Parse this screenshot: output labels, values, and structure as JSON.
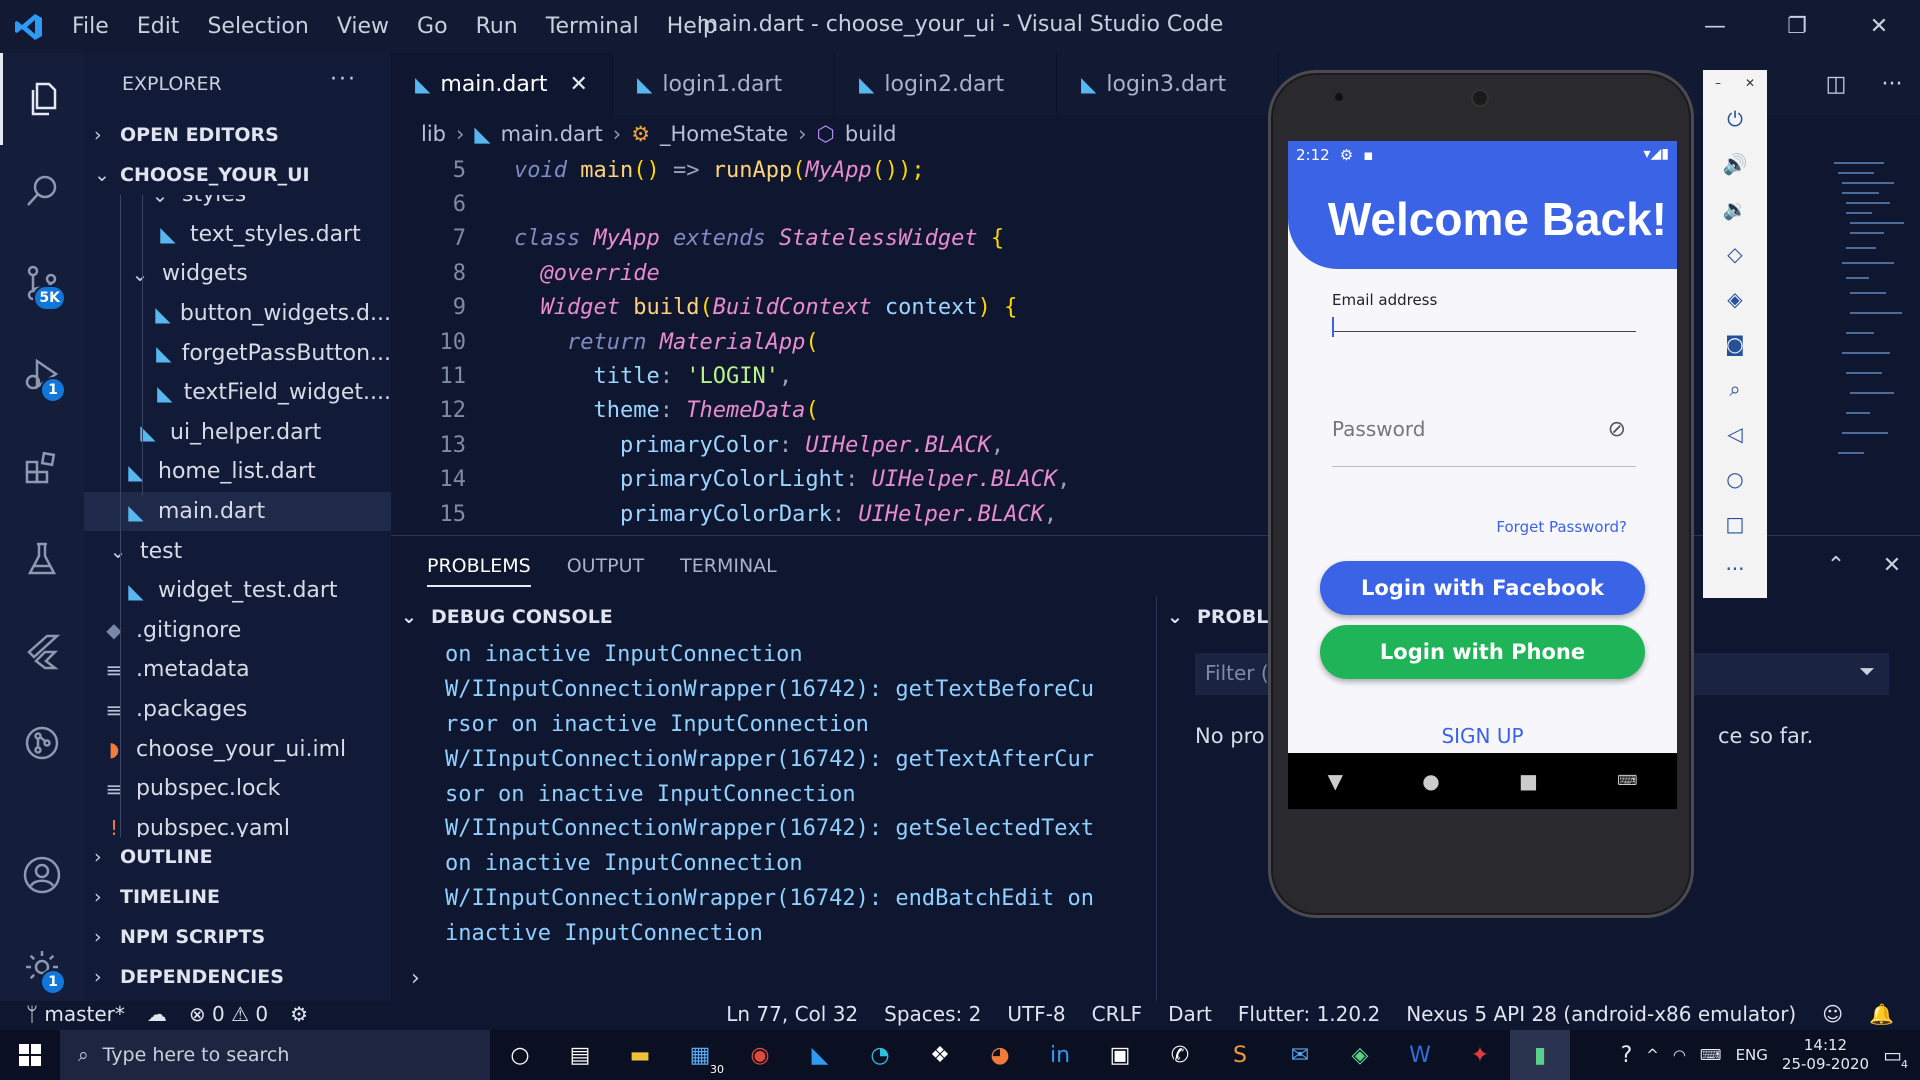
{
  "window": {
    "title": "main.dart - choose_your_ui - Visual Studio Code",
    "menu": [
      "File",
      "Edit",
      "Selection",
      "View",
      "Go",
      "Run",
      "Terminal",
      "Help"
    ]
  },
  "activity": {
    "source_control_badge": "5K",
    "debug_badge": "1",
    "settings_badge": "1"
  },
  "sidebar": {
    "title": "EXPLORER",
    "open_editors": "OPEN EDITORS",
    "project": "CHOOSE_YOUR_UI",
    "items": [
      {
        "label": "styles",
        "type": "folder"
      },
      {
        "label": "text_styles.dart",
        "type": "dart"
      },
      {
        "label": "widgets",
        "type": "folder"
      },
      {
        "label": "button_widgets.d...",
        "type": "dart"
      },
      {
        "label": "forgetPassButton...",
        "type": "dart"
      },
      {
        "label": "textField_widget....",
        "type": "dart"
      },
      {
        "label": "ui_helper.dart",
        "type": "dart"
      },
      {
        "label": "home_list.dart",
        "type": "dart"
      },
      {
        "label": "main.dart",
        "type": "dart"
      },
      {
        "label": "test",
        "type": "folder"
      },
      {
        "label": "widget_test.dart",
        "type": "dart"
      },
      {
        "label": ".gitignore",
        "type": "git"
      },
      {
        "label": ".metadata",
        "type": "lines"
      },
      {
        "label": ".packages",
        "type": "lines"
      },
      {
        "label": "choose_your_ui.iml",
        "type": "rss"
      },
      {
        "label": "pubspec.lock",
        "type": "lines"
      },
      {
        "label": "pubspec.yaml",
        "type": "yaml"
      }
    ],
    "outline": "OUTLINE",
    "timeline": "TIMELINE",
    "npm": "NPM SCRIPTS",
    "deps": "DEPENDENCIES"
  },
  "tabs": [
    {
      "label": "main.dart",
      "active": true
    },
    {
      "label": "login1.dart"
    },
    {
      "label": "login2.dart"
    },
    {
      "label": "login3.dart"
    }
  ],
  "breadcrumb": [
    "lib",
    "main.dart",
    "_HomeState",
    "build"
  ],
  "code_lines": [
    "5",
    "6",
    "7",
    "8",
    "9",
    "10",
    "11",
    "12",
    "13",
    "14",
    "15"
  ],
  "panel": {
    "tabs": [
      "PROBLEMS",
      "OUTPUT",
      "TERMINAL"
    ],
    "debug_title": "DEBUG CONSOLE",
    "problems_title": "PROBLE",
    "filter_placeholder": "Filter (e",
    "no_problems_left": "No pro",
    "no_problems_right": "ce so far.",
    "debug_lines": [
      "on inactive InputConnection",
      "W/IInputConnectionWrapper(16742): getTextBeforeCu",
      "rsor on inactive InputConnection",
      "W/IInputConnectionWrapper(16742): getTextAfterCur",
      "sor on inactive InputConnection",
      "W/IInputConnectionWrapper(16742): getSelectedText",
      "on inactive InputConnection",
      "W/IInputConnectionWrapper(16742): endBatchEdit on",
      "inactive InputConnection"
    ]
  },
  "status": {
    "branch": "master*",
    "errors": "0",
    "warnings": "0",
    "position": "Ln 77, Col 32",
    "spaces": "Spaces: 2",
    "encoding": "UTF-8",
    "eol": "CRLF",
    "language": "Dart",
    "flutter": "Flutter: 1.20.2",
    "device": "Nexus 5 API 28 (android-x86 emulator)"
  },
  "taskbar": {
    "search_placeholder": "Type here to search",
    "store_badge": "30",
    "lang": "ENG",
    "time": "14:12",
    "date": "25-09-2020",
    "notif_count": "4"
  },
  "phone": {
    "time": "2:12",
    "title": "Welcome Back!",
    "email_label": "Email address",
    "password_placeholder": "Password",
    "forget": "Forget Password?",
    "facebook_btn": "Login with Facebook",
    "phone_btn": "Login with Phone",
    "signup": "SIGN UP",
    "facebook_color": "#3b63e6",
    "phone_color": "#1fb457"
  }
}
